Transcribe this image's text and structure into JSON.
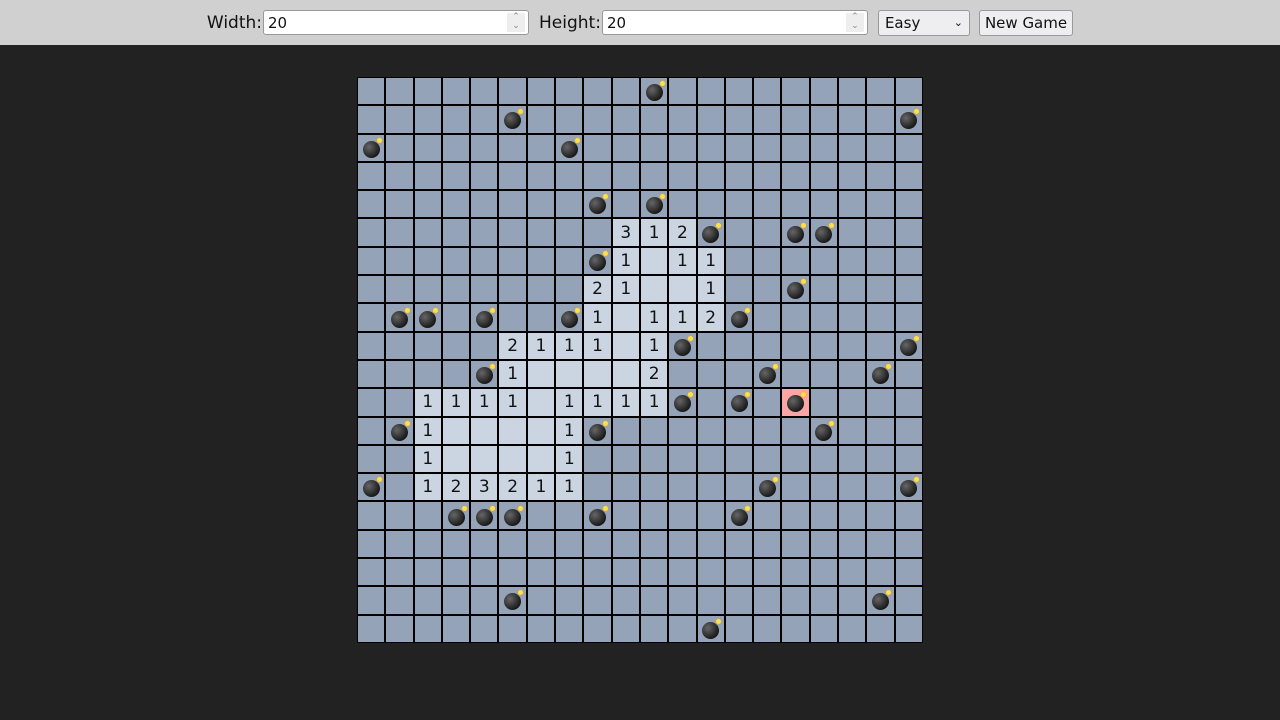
{
  "toolbar": {
    "width_label": "Width:",
    "width_value": "20",
    "height_label": "Height:",
    "height_value": "20",
    "difficulty": "Easy",
    "new_game_label": "New Game"
  },
  "colors": {
    "hidden": "#94a3b8",
    "revealed": "#cbd5e1",
    "exploded": "#fca5a5",
    "background": "#222222"
  },
  "board": {
    "legend": {
      ".": "hidden",
      "o": "revealed-empty",
      "*": "mine",
      "X": "exploded-mine",
      "digit": "adjacent-mine-count"
    },
    "rows": [
      "..........*.........",
      ".....*.............*",
      "*......*............",
      "....................",
      "........*.*.........",
      ".........312*..**...",
      "........*1o11.......",
      "........21oo1..*....",
      ".**.*..*1o112*......",
      ".....2111o1*.......*",
      "....*1oooo2...*...*.",
      "..1111o1111*.*.X....",
      ".*1oooo1*.......*...",
      "..1oooo1............",
      "*.123211......*....*",
      "...***..*....*......",
      "....................",
      "....................",
      ".....*............*.",
      "............*......."
    ]
  }
}
